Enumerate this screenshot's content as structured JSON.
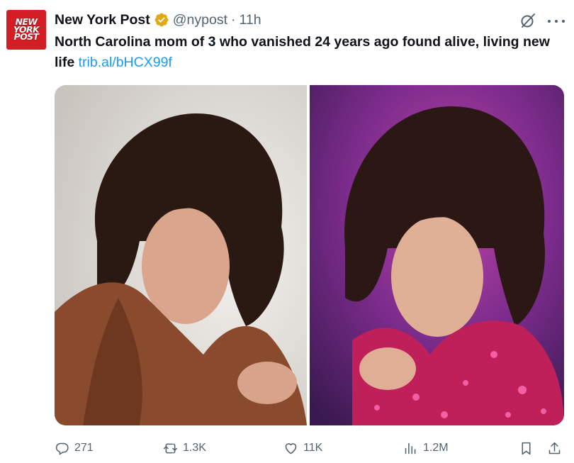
{
  "account": {
    "logo_lines": [
      "NEW",
      "YORK",
      "POST"
    ],
    "name": "New York Post",
    "handle": "@nypost",
    "separator": "·",
    "time": "11h",
    "verified_color": "#e0a813"
  },
  "tweet": {
    "text": "North Carolina mom of 3 who vanished 24 years ago found alive, living new life",
    "link": "trib.al/bHCX99f"
  },
  "media": {
    "photos": [
      {
        "description_icon": "portrait-photo-icon"
      },
      {
        "description_icon": "portrait-photo-icon"
      }
    ]
  },
  "actions": {
    "replies": "271",
    "reposts": "1.3K",
    "likes": "11K",
    "views": "1.2M"
  },
  "colors": {
    "text": "#0f1419",
    "muted": "#536471",
    "link": "#1d9bf0",
    "brand_red": "#d41e26"
  }
}
